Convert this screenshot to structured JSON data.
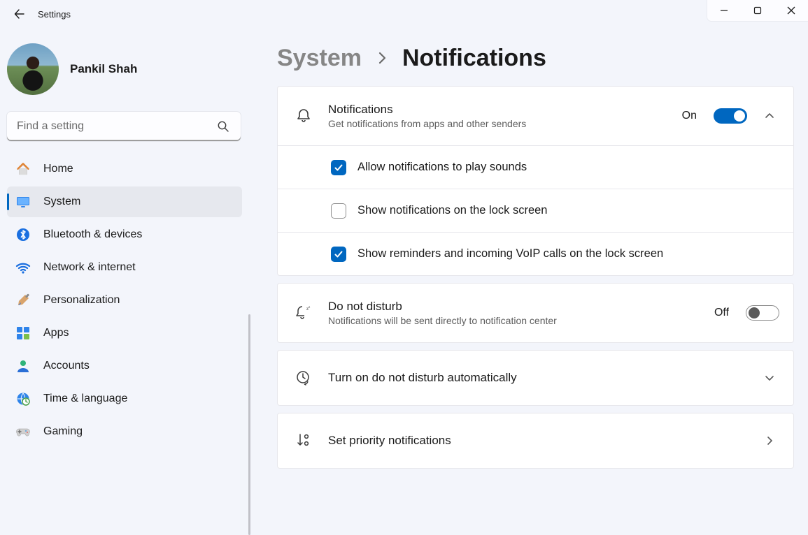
{
  "window": {
    "title": "Settings"
  },
  "user": {
    "name": "Pankil Shah"
  },
  "search": {
    "placeholder": "Find a setting"
  },
  "sidebar": {
    "items": [
      {
        "id": "home",
        "label": "Home"
      },
      {
        "id": "system",
        "label": "System",
        "active": true
      },
      {
        "id": "bt",
        "label": "Bluetooth & devices"
      },
      {
        "id": "net",
        "label": "Network & internet"
      },
      {
        "id": "pers",
        "label": "Personalization"
      },
      {
        "id": "apps",
        "label": "Apps"
      },
      {
        "id": "acct",
        "label": "Accounts"
      },
      {
        "id": "time",
        "label": "Time & language"
      },
      {
        "id": "game",
        "label": "Gaming"
      }
    ]
  },
  "breadcrumb": {
    "root": "System",
    "leaf": "Notifications"
  },
  "panes": {
    "notifications": {
      "title": "Notifications",
      "subtitle": "Get notifications from apps and other senders",
      "state_label": "On",
      "on": true
    },
    "options": [
      {
        "label": "Allow notifications to play sounds",
        "checked": true
      },
      {
        "label": "Show notifications on the lock screen",
        "checked": false
      },
      {
        "label": "Show reminders and incoming VoIP calls on the lock screen",
        "checked": true
      }
    ],
    "dnd": {
      "title": "Do not disturb",
      "subtitle": "Notifications will be sent directly to notification center",
      "state_label": "Off",
      "on": false
    },
    "dnd_auto": {
      "title": "Turn on do not disturb automatically"
    },
    "priority": {
      "title": "Set priority notifications"
    }
  }
}
